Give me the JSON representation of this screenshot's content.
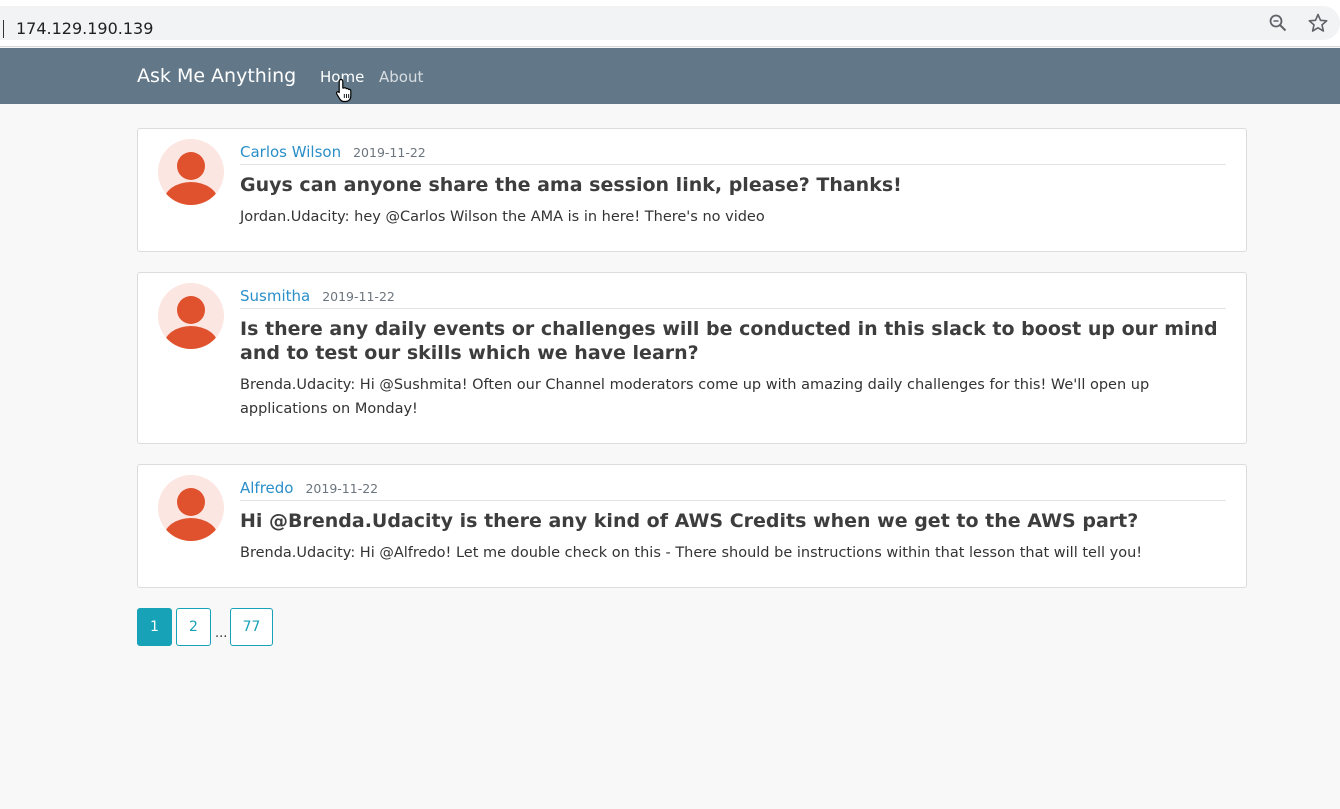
{
  "browser": {
    "url": "174.129.190.139",
    "icons": [
      "zoom-icon",
      "star-icon"
    ]
  },
  "navbar": {
    "brand": "Ask Me Anything",
    "links": [
      {
        "label": "Home",
        "active": true
      },
      {
        "label": "About",
        "active": false
      }
    ],
    "color": "#627889"
  },
  "posts": [
    {
      "author": "Carlos Wilson",
      "date": "2019-11-22",
      "question": "Guys can anyone share the ama session link, please? Thanks!",
      "answer": "Jordan.Udacity: hey @Carlos Wilson the AMA is in here! There's no video"
    },
    {
      "author": "Susmitha",
      "date": "2019-11-22",
      "question": "Is there any daily events or challenges will be conducted in this slack to boost up our mind and to test our skills which we have learn?",
      "answer": "Brenda.Udacity: Hi @Sushmita! Often our Channel moderators come up with amazing daily challenges for this! We'll open up applications on Monday!"
    },
    {
      "author": "Alfredo",
      "date": "2019-11-22",
      "question": "Hi @Brenda.Udacity is there any kind of AWS Credits when we get to the AWS part?",
      "answer": "Brenda.Udacity: Hi @Alfredo! Let me double check on this - There should be instructions within that lesson that will tell you!"
    }
  ],
  "pagination": {
    "pages": [
      "1",
      "2",
      "77"
    ],
    "current": "1",
    "ellipsis": "..."
  },
  "colors": {
    "accent": "#17a2b8",
    "link": "#2a8fc9",
    "avatar": "#e0522d",
    "avatar_bg": "#fbe6e1"
  }
}
